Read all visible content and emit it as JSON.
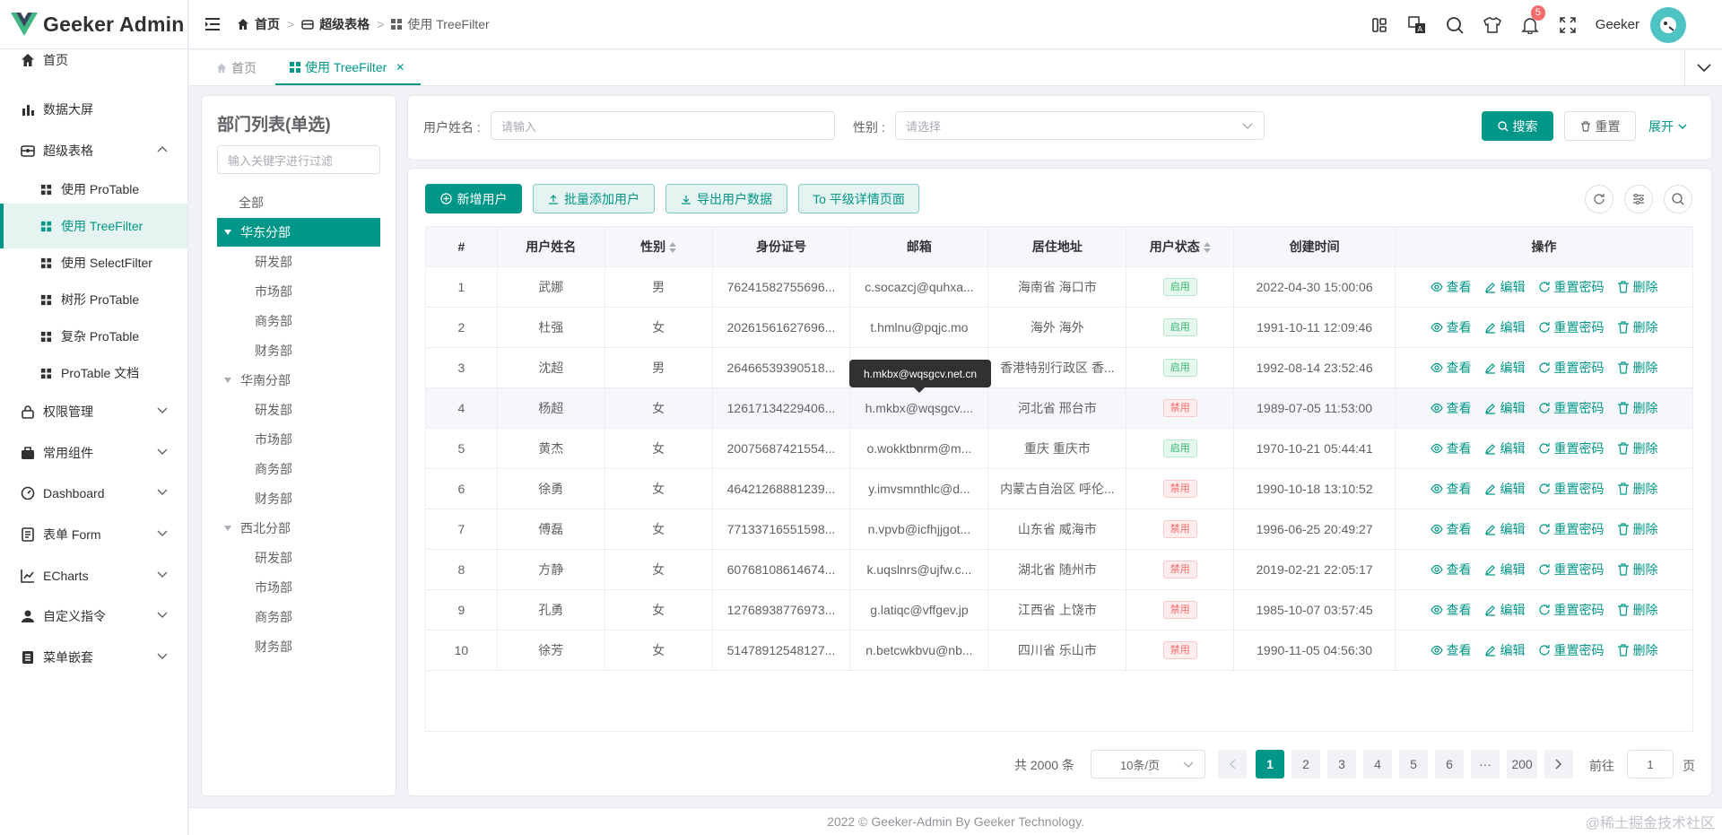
{
  "app": {
    "title": "Geeker Admin",
    "user": "Geeker",
    "notice_count": "5"
  },
  "sidebar": {
    "items": [
      {
        "label": "首页",
        "icon": "home-icon"
      },
      {
        "label": "数据大屏",
        "icon": "chart-bars-icon"
      },
      {
        "label": "超级表格",
        "icon": "table-box-icon",
        "expanded": true
      },
      {
        "label": "使用 ProTable",
        "icon": "grid-icon"
      },
      {
        "label": "使用 TreeFilter",
        "icon": "grid-icon",
        "active": true
      },
      {
        "label": "使用 SelectFilter",
        "icon": "grid-icon"
      },
      {
        "label": "树形 ProTable",
        "icon": "grid-icon"
      },
      {
        "label": "复杂 ProTable",
        "icon": "grid-icon"
      },
      {
        "label": "ProTable 文档",
        "icon": "grid-icon"
      },
      {
        "label": "权限管理",
        "icon": "lock-icon"
      },
      {
        "label": "常用组件",
        "icon": "briefcase-icon"
      },
      {
        "label": "Dashboard",
        "icon": "odometer-icon"
      },
      {
        "label": "表单 Form",
        "icon": "form-icon"
      },
      {
        "label": "ECharts",
        "icon": "line-chart-icon"
      },
      {
        "label": "自定义指令",
        "icon": "user-icon"
      },
      {
        "label": "菜单嵌套",
        "icon": "menu-icon"
      }
    ]
  },
  "breadcrumb": [
    "首页",
    "超级表格",
    "使用 TreeFilter"
  ],
  "tabs": [
    {
      "label": "首页",
      "active": false
    },
    {
      "label": "使用 TreeFilter",
      "active": true
    }
  ],
  "tree": {
    "title": "部门列表(单选)",
    "placeholder": "输入关键字进行过滤",
    "nodes": [
      {
        "label": "全部",
        "level": 0
      },
      {
        "label": "华东分部",
        "level": 1,
        "selected": true
      },
      {
        "label": "研发部",
        "level": 2
      },
      {
        "label": "市场部",
        "level": 2
      },
      {
        "label": "商务部",
        "level": 2
      },
      {
        "label": "财务部",
        "level": 2
      },
      {
        "label": "华南分部",
        "level": 1
      },
      {
        "label": "研发部",
        "level": 2
      },
      {
        "label": "市场部",
        "level": 2
      },
      {
        "label": "商务部",
        "level": 2
      },
      {
        "label": "财务部",
        "level": 2
      },
      {
        "label": "西北分部",
        "level": 1
      },
      {
        "label": "研发部",
        "level": 2
      },
      {
        "label": "市场部",
        "level": 2
      },
      {
        "label": "商务部",
        "level": 2
      },
      {
        "label": "财务部",
        "level": 2
      }
    ]
  },
  "search": {
    "username_label": "用户姓名 :",
    "username_placeholder": "请输入",
    "gender_label": "性别 :",
    "gender_placeholder": "请选择",
    "search_btn": "搜索",
    "reset_btn": "重置",
    "expand_btn": "展开"
  },
  "toolbar": {
    "add": "新增用户",
    "batch": "批量添加用户",
    "export": "导出用户数据",
    "detail": "To 平级详情页面"
  },
  "table": {
    "columns": [
      "#",
      "用户姓名",
      "性别",
      "身份证号",
      "邮箱",
      "居住地址",
      "用户状态",
      "创建时间",
      "操作"
    ],
    "actions": [
      "查看",
      "编辑",
      "重置密码",
      "删除"
    ],
    "status_on": "启用",
    "status_off": "禁用",
    "rows": [
      {
        "no": "1",
        "name": "武娜",
        "gender": "男",
        "id": "76241582755696...",
        "email": "c.socazcj@quhxa...",
        "addr": "海南省 海口市",
        "on": true,
        "time": "2022-04-30 15:00:06"
      },
      {
        "no": "2",
        "name": "杜强",
        "gender": "女",
        "id": "20261561627696...",
        "email": "t.hmlnu@pqjc.mo",
        "addr": "海外 海外",
        "on": true,
        "time": "1991-10-11 12:09:46"
      },
      {
        "no": "3",
        "name": "沈超",
        "gender": "男",
        "id": "26466539390518...",
        "email": "",
        "addr": "香港特别行政区 香...",
        "on": true,
        "time": "1992-08-14 23:52:46"
      },
      {
        "no": "4",
        "name": "杨超",
        "gender": "女",
        "id": "12617134229406...",
        "email": "h.mkbx@wqsgcv....",
        "addr": "河北省 邢台市",
        "on": false,
        "time": "1989-07-05 11:53:00"
      },
      {
        "no": "5",
        "name": "黄杰",
        "gender": "女",
        "id": "20075687421554...",
        "email": "o.wokktbnrm@m...",
        "addr": "重庆 重庆市",
        "on": true,
        "time": "1970-10-21 05:44:41"
      },
      {
        "no": "6",
        "name": "徐勇",
        "gender": "女",
        "id": "46421268881239...",
        "email": "y.imvsmnthlc@d...",
        "addr": "内蒙古自治区 呼伦...",
        "on": false,
        "time": "1990-10-18 13:10:52"
      },
      {
        "no": "7",
        "name": "傅磊",
        "gender": "女",
        "id": "77133716551598...",
        "email": "n.vpvb@icfhjjgot...",
        "addr": "山东省 威海市",
        "on": false,
        "time": "1996-06-25 20:49:27"
      },
      {
        "no": "8",
        "name": "方静",
        "gender": "女",
        "id": "60768108614674...",
        "email": "k.uqslnrs@ujfw.c...",
        "addr": "湖北省 随州市",
        "on": false,
        "time": "2019-02-21 22:05:17"
      },
      {
        "no": "9",
        "name": "孔勇",
        "gender": "女",
        "id": "12768938776973...",
        "email": "g.latiqc@vffgev.jp",
        "addr": "江西省 上饶市",
        "on": false,
        "time": "1985-10-07 03:57:45"
      },
      {
        "no": "10",
        "name": "徐芳",
        "gender": "女",
        "id": "51478912548127...",
        "email": "n.betcwkbvu@nb...",
        "addr": "四川省 乐山市",
        "on": false,
        "time": "1990-11-05 04:56:30"
      }
    ]
  },
  "tooltip": "h.mkbx@wqsgcv.net.cn",
  "pagination": {
    "total": "共 2000 条",
    "size": "10条/页",
    "pages": [
      "1",
      "2",
      "3",
      "4",
      "5",
      "6",
      "···",
      "200"
    ],
    "goto": "前往",
    "goto_value": "1",
    "page_unit": "页"
  },
  "footer": "2022 © Geeker-Admin By Geeker Technology.",
  "watermark": "@稀土掘金技术社区",
  "colors": {
    "primary": "#009688",
    "danger": "#f56c6c",
    "success": "#34b36b"
  }
}
